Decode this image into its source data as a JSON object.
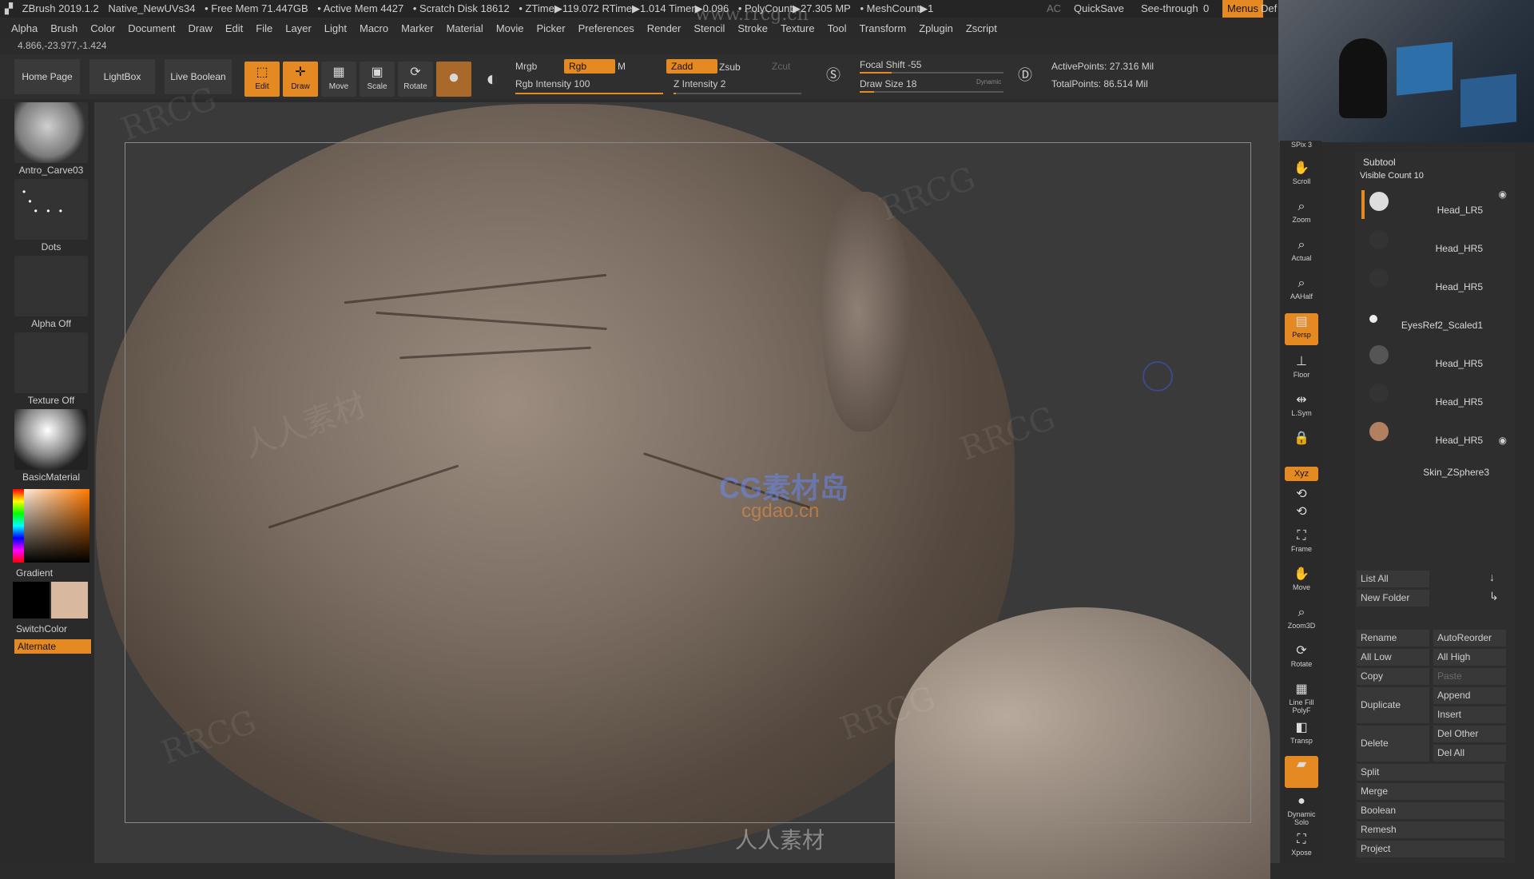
{
  "titlebar": {
    "app": "ZBrush 2019.1.2",
    "file": "Native_NewUVs34",
    "free_mem": "• Free Mem 71.447GB",
    "active_mem": "• Active Mem 4427",
    "scratch": "• Scratch Disk 18612",
    "ztime": "• ZTime▶119.072 RTime▶1.014 Timer▶0.096",
    "polycount": "• PolyCount▶27.305 MP",
    "meshcount": "• MeshCount▶1",
    "ac": "AC",
    "quicksave": "QuickSave",
    "see_through_label": "See-through",
    "see_through_value": "0",
    "menus": "Menus",
    "def": "Def"
  },
  "menubar": [
    "Alpha",
    "Brush",
    "Color",
    "Document",
    "Draw",
    "Edit",
    "File",
    "Layer",
    "Light",
    "Macro",
    "Marker",
    "Material",
    "Movie",
    "Picker",
    "Preferences",
    "Render",
    "Stencil",
    "Stroke",
    "Texture",
    "Tool",
    "Transform",
    "Zplugin",
    "Zscript"
  ],
  "coords": "4.866,-23.977,-1.424",
  "toolbar": {
    "home": "Home Page",
    "lightbox": "LightBox",
    "live_boolean": "Live Boolean",
    "tools": [
      {
        "label": "Edit",
        "icon": "edit-icon",
        "active": true
      },
      {
        "label": "Draw",
        "icon": "draw-icon",
        "active": true
      },
      {
        "label": "Move",
        "icon": "move-icon",
        "active": false
      },
      {
        "label": "Scale",
        "icon": "scale-icon",
        "active": false
      },
      {
        "label": "Rotate",
        "icon": "rotate-icon",
        "active": false
      }
    ],
    "mrgb": "Mrgb",
    "rgb": "Rgb",
    "m": "M",
    "rgb_intensity": "Rgb Intensity 100",
    "zadd": "Zadd",
    "zsub": "Zsub",
    "zcut": "Zcut",
    "z_intensity": "Z Intensity 2",
    "focal_shift": "Focal Shift -55",
    "draw_size": "Draw Size 18",
    "dynamic": "Dynamic",
    "active_points": "ActivePoints: 27.316 Mil",
    "total_points": "TotalPoints: 86.514 Mil",
    "rgb_intensity_value": 1.0,
    "z_intensity_value": 0.02
  },
  "leftshelf": {
    "brush": "Antro_Carve03",
    "stroke": "Dots",
    "alpha": "Alpha Off",
    "texture": "Texture Off",
    "material": "BasicMaterial",
    "gradient": "Gradient",
    "switch_color": "SwitchColor",
    "alternate": "Alternate",
    "main_color": "#ffffff",
    "secondary_color": "#000000",
    "skin_color": "#d9b8a0"
  },
  "righttools": [
    {
      "label": "SPix 3",
      "icon": "spix-icon"
    },
    {
      "label": "Scroll",
      "icon": "scroll-icon"
    },
    {
      "label": "Zoom",
      "icon": "zoom-icon"
    },
    {
      "label": "Actual",
      "icon": "actual-icon"
    },
    {
      "label": "AAHalf",
      "icon": "aahalf-icon"
    },
    {
      "label": "Persp",
      "icon": "persp-icon",
      "active": true
    },
    {
      "label": "Floor",
      "icon": "floor-icon"
    },
    {
      "label": "L.Sym",
      "icon": "lsym-icon"
    },
    {
      "label": "",
      "icon": "lock-icon"
    },
    {
      "label": "Xyz",
      "icon": "xyz-icon",
      "active": true
    },
    {
      "label": "Frame",
      "icon": "frame-icon"
    },
    {
      "label": "Move",
      "icon": "move-view-icon"
    },
    {
      "label": "Zoom3D",
      "icon": "zoom3d-icon"
    },
    {
      "label": "Rotate",
      "icon": "rotate-view-icon"
    },
    {
      "label": "Line Fill PolyF",
      "icon": "polyf-icon"
    },
    {
      "label": "Transp",
      "icon": "transp-icon"
    },
    {
      "label": "Ghost",
      "icon": "ghost-icon",
      "active": true
    },
    {
      "label": "Dynamic Solo",
      "icon": "solo-icon"
    },
    {
      "label": "Xpose",
      "icon": "xpose-icon"
    }
  ],
  "subtool": {
    "title": "Subtool",
    "visible_count": "Visible Count 10",
    "items": [
      "Head_LR5",
      "Head_HR5",
      "Head_HR5",
      "EyesRef2_Scaled1",
      "Head_HR5",
      "Head_HR5",
      "Head_HR5",
      "Skin_ZSphere3"
    ],
    "list_all": "List All",
    "new_folder": "New Folder",
    "rename": "Rename",
    "autoreorder": "AutoReorder",
    "all_low": "All Low",
    "all_high": "All High",
    "copy": "Copy",
    "paste": "Paste",
    "duplicate": "Duplicate",
    "append": "Append",
    "insert": "Insert",
    "delete": "Delete",
    "del_other": "Del Other",
    "del_all": "Del All",
    "split": "Split",
    "merge": "Merge",
    "boolean": "Boolean",
    "remesh": "Remesh",
    "project": "Project"
  },
  "watermarks": {
    "rrcg": "RRCG",
    "site": "www.rrcg.cn",
    "cg": "CG素材岛",
    "cgdao": "cgdao.cn",
    "renren": "人人素材"
  }
}
